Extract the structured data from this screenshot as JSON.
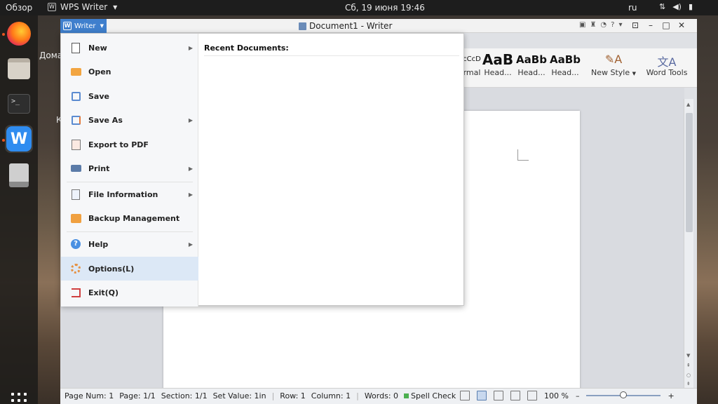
{
  "topbar": {
    "overview": "Обзор",
    "app_name": "WPS Writer",
    "clock": "Сб, 19 июня  19:46",
    "lang": "ru"
  },
  "desktop": {
    "label1": "Дома",
    "label2": "К"
  },
  "window": {
    "app_button": "Writer",
    "title": "Document1 - Writer"
  },
  "ribbon": {
    "styles": [
      {
        "sample": "cCcD",
        "name": "rmal"
      },
      {
        "sample": "AaB",
        "name": "Head..."
      },
      {
        "sample": "AaBb",
        "name": "Head..."
      },
      {
        "sample": "AaBb",
        "name": "Head..."
      }
    ],
    "new_style": "New Style",
    "word_tools": "Word Tools"
  },
  "file_menu": {
    "items": [
      {
        "label": "New",
        "has_sub": true,
        "icon": "new-document-icon"
      },
      {
        "label": "Open",
        "has_sub": false,
        "icon": "open-folder-icon"
      },
      {
        "label": "Save",
        "has_sub": false,
        "icon": "save-icon"
      },
      {
        "label": "Save As",
        "has_sub": true,
        "icon": "save-as-icon"
      },
      {
        "label": "Export to PDF",
        "has_sub": false,
        "icon": "export-pdf-icon"
      },
      {
        "label": "Print",
        "has_sub": true,
        "icon": "printer-icon"
      },
      {
        "label": "File Information",
        "has_sub": true,
        "icon": "file-info-icon"
      },
      {
        "label": "Backup Management",
        "has_sub": false,
        "icon": "backup-icon"
      },
      {
        "label": "Help",
        "has_sub": true,
        "icon": "help-icon"
      },
      {
        "label": "Options(L)",
        "has_sub": false,
        "icon": "gear-icon"
      },
      {
        "label": "Exit(Q)",
        "has_sub": false,
        "icon": "exit-icon"
      }
    ],
    "recent_title": "Recent Documents:"
  },
  "statusbar": {
    "page_num": "Page Num: 1",
    "page": "Page: 1/1",
    "section": "Section: 1/1",
    "set_value": "Set Value: 1in",
    "row": "Row: 1",
    "column": "Column: 1",
    "words": "Words: 0",
    "spell_check": "Spell Check",
    "zoom": "100 %"
  }
}
